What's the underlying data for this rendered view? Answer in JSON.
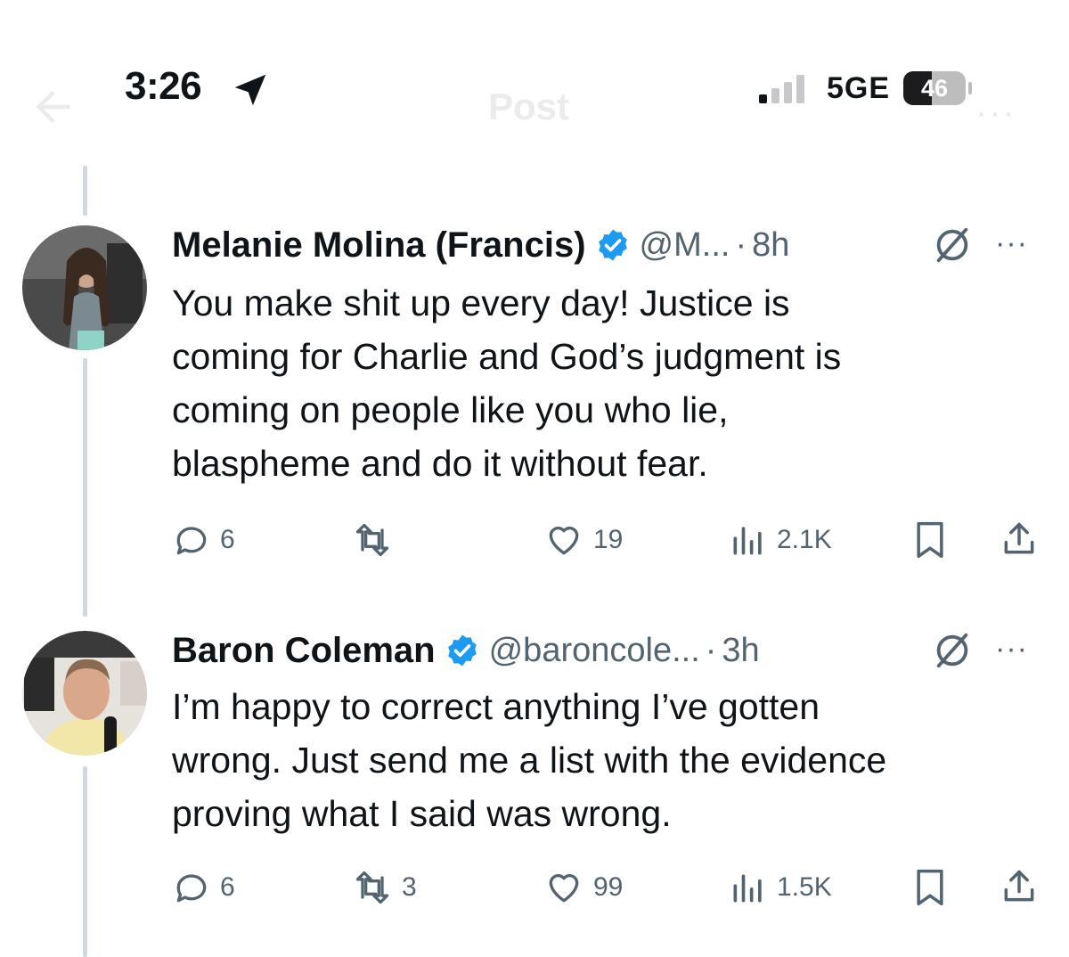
{
  "status_bar": {
    "time": "3:26",
    "network": "5GE",
    "battery_level": "46",
    "battery_percent": 46,
    "icons": [
      "location-arrow-icon",
      "signal-icon",
      "battery-icon"
    ]
  },
  "header": {
    "title": "Post",
    "back_icon": "arrow-left-icon",
    "more_icon": "ellipsis-icon"
  },
  "tweets": [
    {
      "name": "Melanie Molina (Francis)",
      "verified": true,
      "handle": "@M...",
      "separator": "·",
      "time": "8h",
      "more": "···",
      "text_lines": [
        "You make shit up every day! Justice is",
        "coming for Charlie and God’s judgment is",
        "coming on people like you who lie,",
        "blaspheme and do it without fear."
      ],
      "replies": "6",
      "retweets": "",
      "likes": "19",
      "views": "2.1K"
    },
    {
      "name": "Baron Coleman",
      "verified": true,
      "handle": "@baroncole...",
      "separator": "·",
      "time": "3h",
      "more": "···",
      "text_lines": [
        "I’m happy to correct anything I’ve gotten",
        "wrong.  Just send me a list with the evidence",
        "proving what I said was wrong."
      ],
      "replies": "6",
      "retweets": "3",
      "likes": "99",
      "views": "1.5K"
    }
  ],
  "colors": {
    "text": "#0f1419",
    "secondary": "#536471",
    "verified_blue": "#1d9bf0",
    "thread_line": "#cfd9de"
  }
}
